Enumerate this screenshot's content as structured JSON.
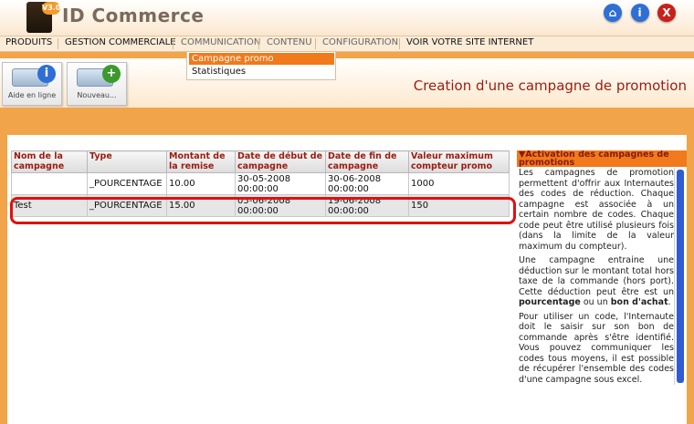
{
  "app": {
    "logo_badge": "V3.0",
    "logo_text": "ID Commerce"
  },
  "header_icons": [
    {
      "name": "home-icon",
      "glyph": "⌂",
      "color": "#2e6fd6"
    },
    {
      "name": "info-icon",
      "glyph": "i",
      "color": "#2e6fd6"
    },
    {
      "name": "close-icon",
      "glyph": "X",
      "color": "#c8201a"
    }
  ],
  "menu": {
    "items": [
      "PRODUITS",
      "GESTION COMMERCIALE",
      "COMMUNICATION",
      "CONTENU",
      "CONFIGURATION",
      "VOIR VOTRE SITE INTERNET"
    ],
    "dropdown": [
      "Campagne promo",
      "Statistiques"
    ]
  },
  "toolbar": {
    "help_label": "Aide en ligne",
    "new_label": "Nouveau..."
  },
  "page": {
    "title": "Creation d'une campagne de promotion"
  },
  "table": {
    "headers": [
      "Nom de la campagne",
      "Type",
      "Montant de la remise",
      "Date de début de campagne",
      "Date de fin de campagne",
      "Valeur maximum compteur promo"
    ],
    "rows": [
      [
        "",
        "_POURCENTAGE",
        "10.00",
        "30-05-2008 00:00:00",
        "30-06-2008 00:00:00",
        "1000"
      ],
      [
        "Test",
        "_POURCENTAGE",
        "15.00",
        "05-06-2008 00:00:00",
        "19-06-2008 00:00:00",
        "150"
      ]
    ]
  },
  "side": {
    "title": "▼Activation des campagnes de promotions",
    "p1": "Les campagnes de promotion permettent d'offrir aux Internautes des codes de réduction. Chaque campagne est associée à un certain nombre de codes. Chaque code peut être utilisé plusieurs fois (dans la limite de la valeur maximum du compteur).",
    "p2a": "Une campagne entraine une déduction sur le montant total hors taxe de la commande (hors port). Cette déduction peut être est un ",
    "p2b": "pourcentage",
    "p2c": " ou un ",
    "p2d": "bon d'achat",
    "p2e": ".",
    "p3": "Pour utiliser un code, l'Internaute doit le saisir sur son bon de commande après s'être identifié. Vous pouvez communiquer les codes tous moyens, il est possible de récupérer l'ensemble des codes d'une campagne sous excel."
  },
  "colors": {
    "accent": "#f07a1c",
    "title_red": "#9b1c10",
    "highlight": "#e01010"
  }
}
